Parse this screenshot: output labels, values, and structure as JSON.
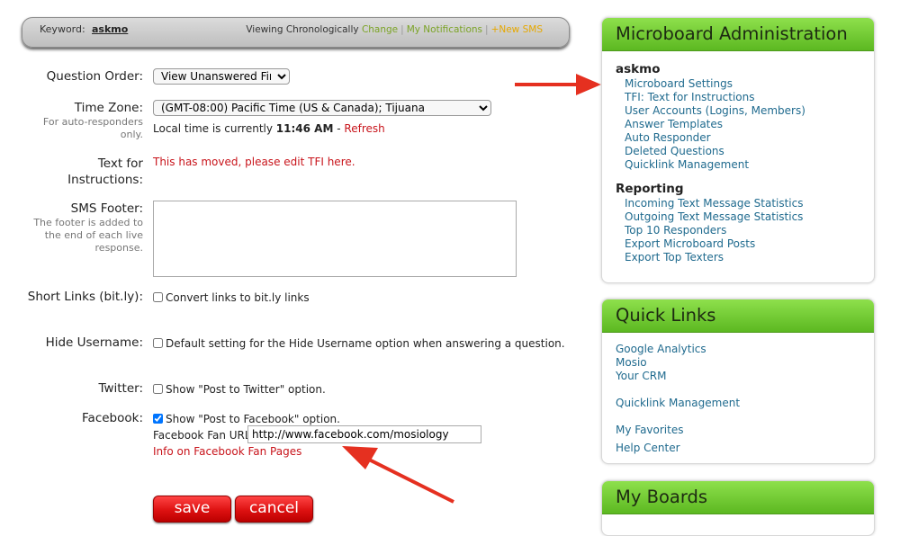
{
  "keyword_bar": {
    "label": "Keyword:",
    "value": "askmo",
    "viewing": "Viewing Chronologically",
    "change": "Change",
    "notifications": "My Notifications",
    "new_sms": "+New SMS"
  },
  "form": {
    "question_order": {
      "label": "Question Order:",
      "selected": "View Unanswered First"
    },
    "time_zone": {
      "label": "Time Zone:",
      "help": "For auto-responders only.",
      "selected": "(GMT-08:00) Pacific Time (US & Canada); Tijuana",
      "local_time_prefix": "Local time is currently",
      "local_time": "11:46 AM",
      "dash": "-",
      "refresh": "Refresh"
    },
    "text_for_instructions": {
      "label": "Text for Instructions:",
      "moved": "This has moved, please edit TFI here."
    },
    "sms_footer": {
      "label": "SMS Footer:",
      "help": "The footer is added to the end of each live response.",
      "value": ""
    },
    "short_links": {
      "label": "Short Links (bit.ly):",
      "checkbox": "Convert links to bit.ly links",
      "checked": false
    },
    "hide_username": {
      "label": "Hide Username:",
      "checkbox": "Default setting for the Hide Username option when answering a question.",
      "checked": false
    },
    "twitter": {
      "label": "Twitter:",
      "checkbox": "Show \"Post to Twitter\" option.",
      "checked": false
    },
    "facebook": {
      "label": "Facebook:",
      "checkbox": "Show \"Post to Facebook\" option.",
      "checked": true,
      "fan_url_label": "Facebook Fan URL:",
      "fan_url_value": "http://www.facebook.com/mosiology",
      "info_link": "Info on Facebook Fan Pages"
    },
    "save": "save",
    "cancel": "cancel"
  },
  "admin_panel": {
    "title": "Microboard Administration",
    "section1": "askmo",
    "links1": [
      "Microboard Settings",
      "TFI: Text for Instructions",
      "User Accounts (Logins, Members)",
      "Answer Templates",
      "Auto Responder",
      "Deleted Questions",
      "Quicklink Management"
    ],
    "section2": "Reporting",
    "links2": [
      "Incoming Text Message Statistics",
      "Outgoing Text Message Statistics",
      "Top 10 Responders",
      "Export Microboard Posts",
      "Export Top Texters"
    ]
  },
  "quick_links": {
    "title": "Quick Links",
    "links": [
      "Google Analytics",
      "Mosio",
      "Your CRM",
      "Quicklink Management",
      "My Favorites",
      "Help Center"
    ]
  },
  "my_boards": {
    "title": "My Boards"
  },
  "colors": {
    "accent_green": "#6cc52c",
    "link_blue": "#1f6a8e",
    "alert_red": "#c8141b",
    "button_red": "#d11111"
  }
}
